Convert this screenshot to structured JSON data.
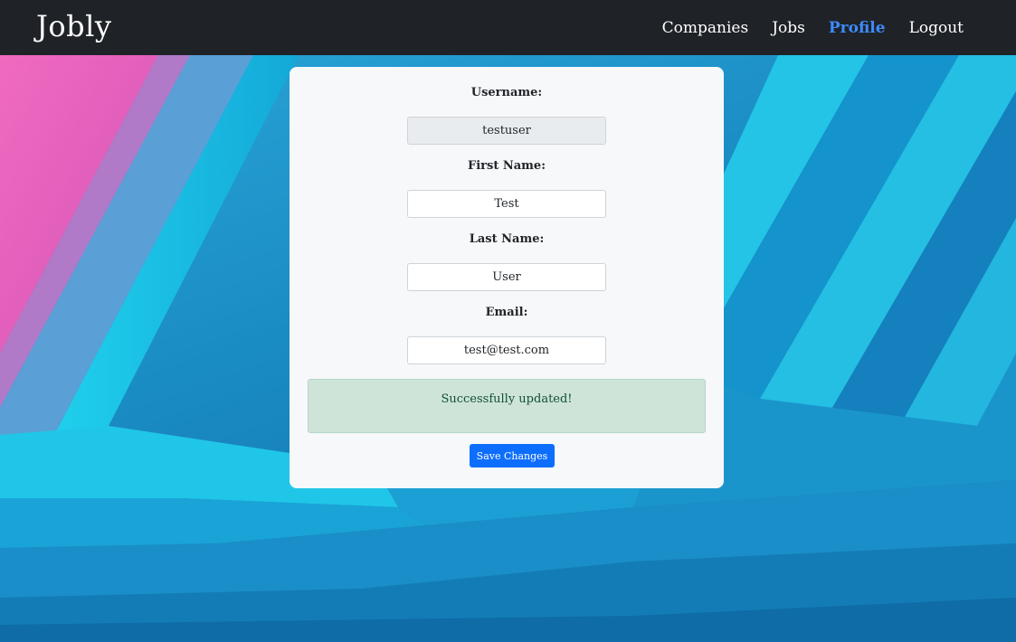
{
  "navbar": {
    "brand": "Jobly",
    "links": [
      {
        "label": "Companies",
        "active": false
      },
      {
        "label": "Jobs",
        "active": false
      },
      {
        "label": "Profile",
        "active": true
      },
      {
        "label": "Logout",
        "active": false
      }
    ]
  },
  "form": {
    "fields": [
      {
        "label": "Username:",
        "value": "testuser",
        "disabled": true
      },
      {
        "label": "First Name:",
        "value": "Test",
        "disabled": false
      },
      {
        "label": "Last Name:",
        "value": "User",
        "disabled": false
      },
      {
        "label": "Email:",
        "value": "test@test.com",
        "disabled": false
      }
    ],
    "alert_message": "Successfully updated!",
    "save_label": "Save Changes"
  },
  "colors": {
    "navbar_bg": "#1f2328",
    "active_link": "#3d8bfd",
    "button": "#0d6efd",
    "alert_bg": "#cfe4d9",
    "background_accent_pink": "#e85fb8",
    "background_accent_cyan": "#22c8e8"
  }
}
